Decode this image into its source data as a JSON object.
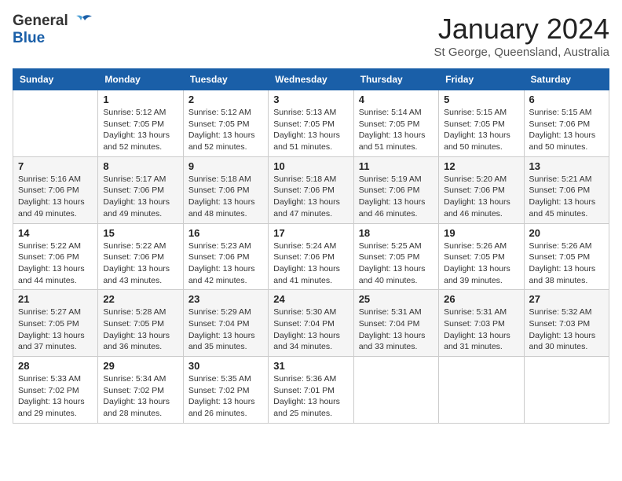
{
  "logo": {
    "general": "General",
    "blue": "Blue"
  },
  "header": {
    "month": "January 2024",
    "location": "St George, Queensland, Australia"
  },
  "columns": [
    "Sunday",
    "Monday",
    "Tuesday",
    "Wednesday",
    "Thursday",
    "Friday",
    "Saturday"
  ],
  "weeks": [
    [
      {
        "day": "",
        "info": ""
      },
      {
        "day": "1",
        "info": "Sunrise: 5:12 AM\nSunset: 7:05 PM\nDaylight: 13 hours\nand 52 minutes."
      },
      {
        "day": "2",
        "info": "Sunrise: 5:12 AM\nSunset: 7:05 PM\nDaylight: 13 hours\nand 52 minutes."
      },
      {
        "day": "3",
        "info": "Sunrise: 5:13 AM\nSunset: 7:05 PM\nDaylight: 13 hours\nand 51 minutes."
      },
      {
        "day": "4",
        "info": "Sunrise: 5:14 AM\nSunset: 7:05 PM\nDaylight: 13 hours\nand 51 minutes."
      },
      {
        "day": "5",
        "info": "Sunrise: 5:15 AM\nSunset: 7:05 PM\nDaylight: 13 hours\nand 50 minutes."
      },
      {
        "day": "6",
        "info": "Sunrise: 5:15 AM\nSunset: 7:06 PM\nDaylight: 13 hours\nand 50 minutes."
      }
    ],
    [
      {
        "day": "7",
        "info": "Sunrise: 5:16 AM\nSunset: 7:06 PM\nDaylight: 13 hours\nand 49 minutes."
      },
      {
        "day": "8",
        "info": "Sunrise: 5:17 AM\nSunset: 7:06 PM\nDaylight: 13 hours\nand 49 minutes."
      },
      {
        "day": "9",
        "info": "Sunrise: 5:18 AM\nSunset: 7:06 PM\nDaylight: 13 hours\nand 48 minutes."
      },
      {
        "day": "10",
        "info": "Sunrise: 5:18 AM\nSunset: 7:06 PM\nDaylight: 13 hours\nand 47 minutes."
      },
      {
        "day": "11",
        "info": "Sunrise: 5:19 AM\nSunset: 7:06 PM\nDaylight: 13 hours\nand 46 minutes."
      },
      {
        "day": "12",
        "info": "Sunrise: 5:20 AM\nSunset: 7:06 PM\nDaylight: 13 hours\nand 46 minutes."
      },
      {
        "day": "13",
        "info": "Sunrise: 5:21 AM\nSunset: 7:06 PM\nDaylight: 13 hours\nand 45 minutes."
      }
    ],
    [
      {
        "day": "14",
        "info": "Sunrise: 5:22 AM\nSunset: 7:06 PM\nDaylight: 13 hours\nand 44 minutes."
      },
      {
        "day": "15",
        "info": "Sunrise: 5:22 AM\nSunset: 7:06 PM\nDaylight: 13 hours\nand 43 minutes."
      },
      {
        "day": "16",
        "info": "Sunrise: 5:23 AM\nSunset: 7:06 PM\nDaylight: 13 hours\nand 42 minutes."
      },
      {
        "day": "17",
        "info": "Sunrise: 5:24 AM\nSunset: 7:06 PM\nDaylight: 13 hours\nand 41 minutes."
      },
      {
        "day": "18",
        "info": "Sunrise: 5:25 AM\nSunset: 7:05 PM\nDaylight: 13 hours\nand 40 minutes."
      },
      {
        "day": "19",
        "info": "Sunrise: 5:26 AM\nSunset: 7:05 PM\nDaylight: 13 hours\nand 39 minutes."
      },
      {
        "day": "20",
        "info": "Sunrise: 5:26 AM\nSunset: 7:05 PM\nDaylight: 13 hours\nand 38 minutes."
      }
    ],
    [
      {
        "day": "21",
        "info": "Sunrise: 5:27 AM\nSunset: 7:05 PM\nDaylight: 13 hours\nand 37 minutes."
      },
      {
        "day": "22",
        "info": "Sunrise: 5:28 AM\nSunset: 7:05 PM\nDaylight: 13 hours\nand 36 minutes."
      },
      {
        "day": "23",
        "info": "Sunrise: 5:29 AM\nSunset: 7:04 PM\nDaylight: 13 hours\nand 35 minutes."
      },
      {
        "day": "24",
        "info": "Sunrise: 5:30 AM\nSunset: 7:04 PM\nDaylight: 13 hours\nand 34 minutes."
      },
      {
        "day": "25",
        "info": "Sunrise: 5:31 AM\nSunset: 7:04 PM\nDaylight: 13 hours\nand 33 minutes."
      },
      {
        "day": "26",
        "info": "Sunrise: 5:31 AM\nSunset: 7:03 PM\nDaylight: 13 hours\nand 31 minutes."
      },
      {
        "day": "27",
        "info": "Sunrise: 5:32 AM\nSunset: 7:03 PM\nDaylight: 13 hours\nand 30 minutes."
      }
    ],
    [
      {
        "day": "28",
        "info": "Sunrise: 5:33 AM\nSunset: 7:02 PM\nDaylight: 13 hours\nand 29 minutes."
      },
      {
        "day": "29",
        "info": "Sunrise: 5:34 AM\nSunset: 7:02 PM\nDaylight: 13 hours\nand 28 minutes."
      },
      {
        "day": "30",
        "info": "Sunrise: 5:35 AM\nSunset: 7:02 PM\nDaylight: 13 hours\nand 26 minutes."
      },
      {
        "day": "31",
        "info": "Sunrise: 5:36 AM\nSunset: 7:01 PM\nDaylight: 13 hours\nand 25 minutes."
      },
      {
        "day": "",
        "info": ""
      },
      {
        "day": "",
        "info": ""
      },
      {
        "day": "",
        "info": ""
      }
    ]
  ]
}
